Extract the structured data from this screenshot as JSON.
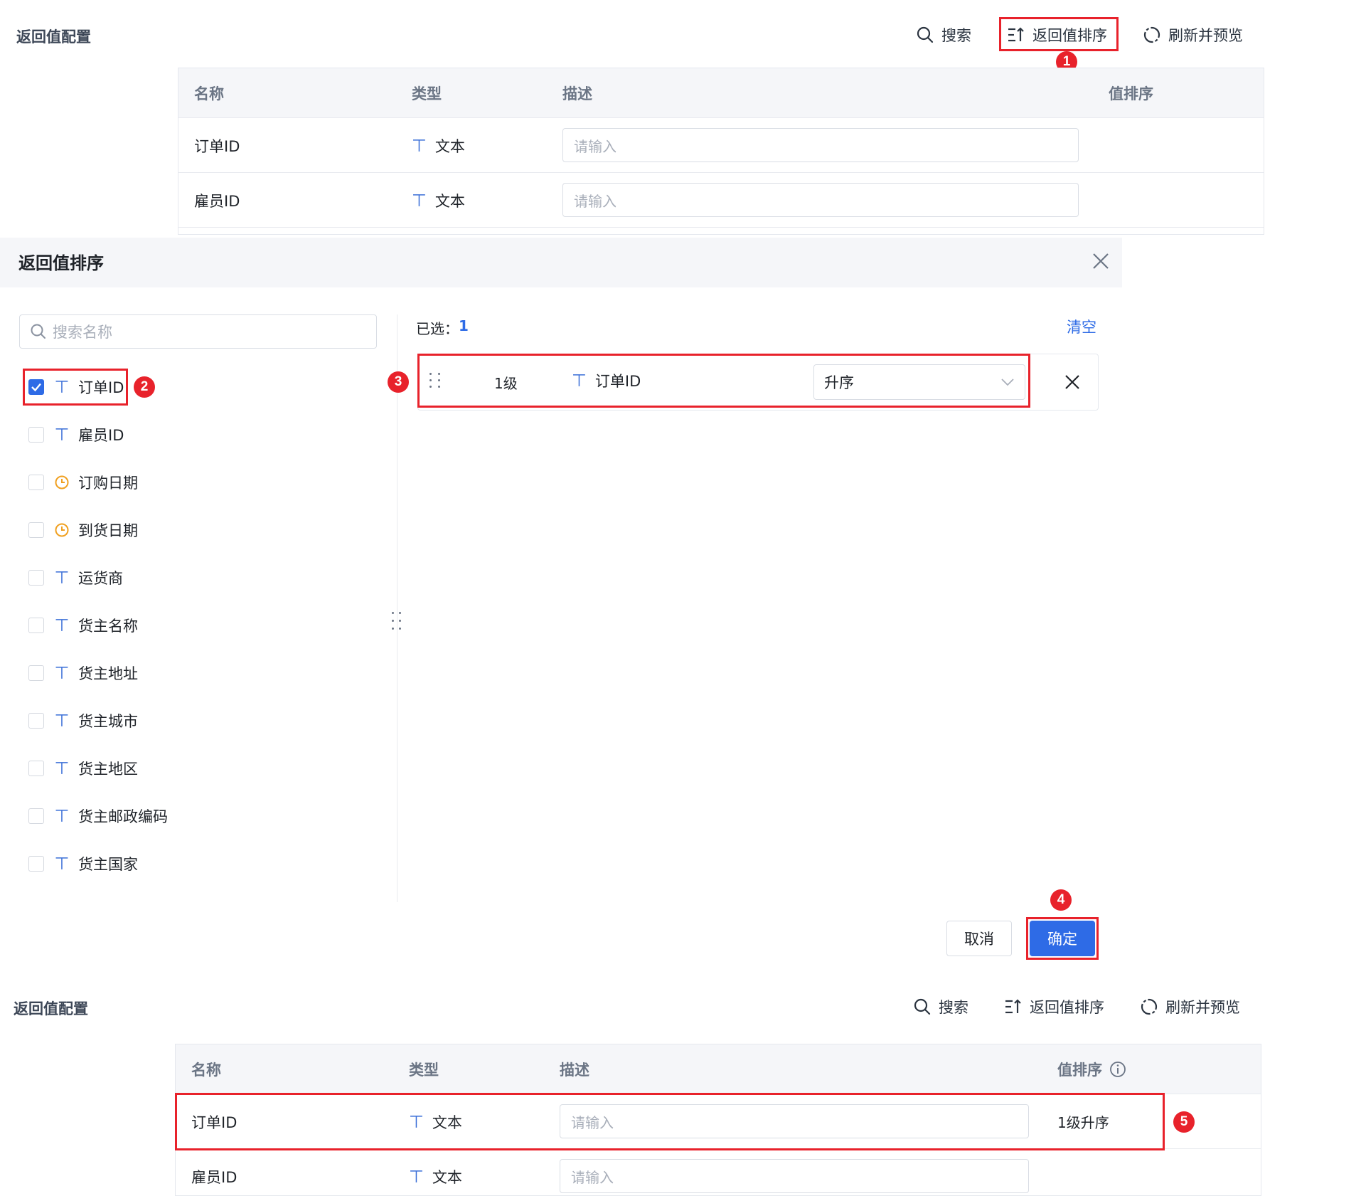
{
  "top": {
    "title": "返回值配置",
    "toolbar": {
      "search": "搜索",
      "sort": "返回值排序",
      "refresh": "刷新并预览"
    },
    "headers": {
      "name": "名称",
      "type": "类型",
      "desc": "描述",
      "sort": "值排序"
    },
    "rows": [
      {
        "name": "订单ID",
        "type": "文本",
        "placeholder": "请输入"
      },
      {
        "name": "雇员ID",
        "type": "文本",
        "placeholder": "请输入"
      }
    ]
  },
  "dialog": {
    "title": "返回值排序",
    "search_placeholder": "搜索名称",
    "selected_label": "已选：",
    "selected_count": "1",
    "clear": "清空",
    "fields": [
      {
        "name": "订单ID",
        "icon": "text-icon",
        "checked": true
      },
      {
        "name": "雇员ID",
        "icon": "text-icon",
        "checked": false
      },
      {
        "name": "订购日期",
        "icon": "clock-icon",
        "checked": false
      },
      {
        "name": "到货日期",
        "icon": "clock-icon",
        "checked": false
      },
      {
        "name": "运货商",
        "icon": "text-icon",
        "checked": false
      },
      {
        "name": "货主名称",
        "icon": "text-icon",
        "checked": false
      },
      {
        "name": "货主地址",
        "icon": "text-icon",
        "checked": false
      },
      {
        "name": "货主城市",
        "icon": "text-icon",
        "checked": false
      },
      {
        "name": "货主地区",
        "icon": "text-icon",
        "checked": false
      },
      {
        "name": "货主邮政编码",
        "icon": "text-icon",
        "checked": false
      },
      {
        "name": "货主国家",
        "icon": "text-icon",
        "checked": false
      }
    ],
    "sort_item": {
      "level": "1级",
      "field": "订单ID",
      "order": "升序"
    },
    "cancel": "取消",
    "confirm": "确定"
  },
  "bottom": {
    "title": "返回值配置",
    "toolbar": {
      "search": "搜索",
      "sort": "返回值排序",
      "refresh": "刷新并预览"
    },
    "headers": {
      "name": "名称",
      "type": "类型",
      "desc": "描述",
      "sort": "值排序"
    },
    "rows": [
      {
        "name": "订单ID",
        "type": "文本",
        "placeholder": "请输入",
        "sort": "1级升序"
      },
      {
        "name": "雇员ID",
        "type": "文本",
        "placeholder": "请输入",
        "sort": ""
      }
    ]
  },
  "badges": [
    "1",
    "2",
    "3",
    "4",
    "5"
  ],
  "colors": {
    "accent": "#2e6be6",
    "annotation": "#e8222b",
    "header_bg": "#f5f6f9",
    "time_icon": "#f0a020"
  }
}
